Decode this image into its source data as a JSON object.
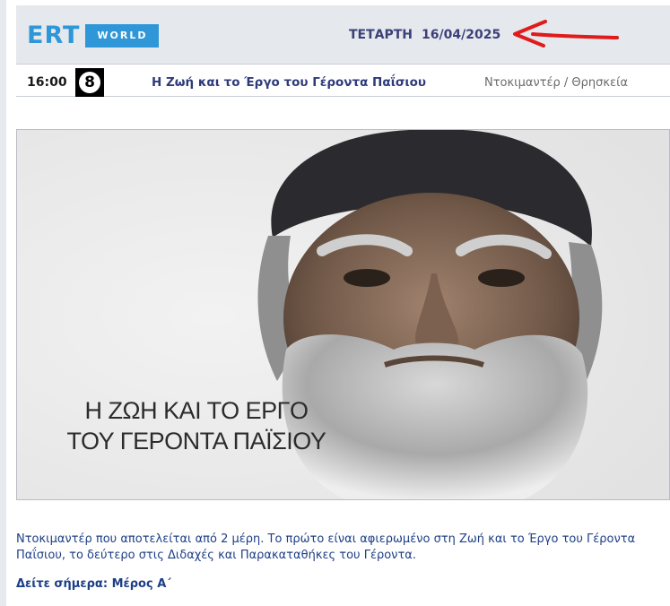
{
  "header": {
    "logo_text": "ERT",
    "logo_badge": "WORLD",
    "day": "ΤΕΤΑΡΤΗ",
    "date": "16/04/2025"
  },
  "program": {
    "time": "16:00",
    "rating": "8",
    "title": "Η Ζωή και το Έργο του Γέροντα Παΐσιου",
    "genre": "Ντοκιμαντέρ / Θρησκεία"
  },
  "hero": {
    "title_line1": "Η ΖΩΗ ΚΑΙ ΤΟ ΕΡΓΟ",
    "title_line2": "ΤΟΥ ΓΕΡΟΝΤΑ ΠΑΪΣΙΟΥ"
  },
  "description": {
    "line1": "Ντοκιμαντέρ που αποτελείται από 2 μέρη. Το πρώτο είναι αφιερωμένο στη Ζωή και το Έργο του Γέροντα",
    "line2": "Παΐσιου, το δεύτερο στις Διδαχές και Παρακαταθήκες του Γέροντα."
  },
  "today": "Δείτε σήμερα: Μέρος Α΄",
  "colors": {
    "brand": "#2f97d8",
    "date_text": "#3b3f7a",
    "link_text": "#1d3f86",
    "arrow": "#e01b1b"
  }
}
